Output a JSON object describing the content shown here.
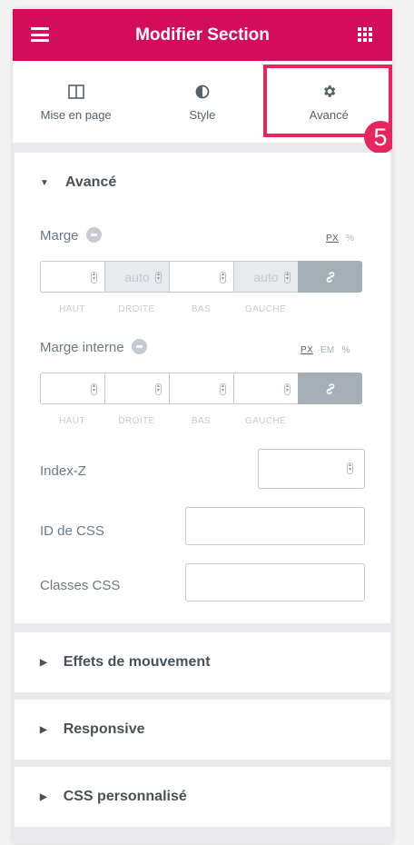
{
  "header": {
    "title": "Modifier Section"
  },
  "tabs": [
    {
      "label": "Mise en page",
      "icon": "columns-icon"
    },
    {
      "label": "Style",
      "icon": "contrast-icon"
    },
    {
      "label": "Avancé",
      "icon": "gear-icon"
    }
  ],
  "annotation": {
    "step": "5",
    "color": "#e8265e"
  },
  "advanced": {
    "title": "Avancé",
    "marge": {
      "label": "Marge",
      "units": [
        "PX",
        "%"
      ],
      "fields": [
        {
          "value": "",
          "label": "HAUT"
        },
        {
          "value": "auto",
          "label": "DROITE"
        },
        {
          "value": "",
          "label": "BAS"
        },
        {
          "value": "auto",
          "label": "GAUCHE"
        }
      ]
    },
    "marge_interne": {
      "label": "Marge interne",
      "units": [
        "PX",
        "EM",
        "%"
      ],
      "fields": [
        {
          "value": "",
          "label": "HAUT"
        },
        {
          "value": "",
          "label": "DROITE"
        },
        {
          "value": "",
          "label": "BAS"
        },
        {
          "value": "",
          "label": "GAUCHE"
        }
      ]
    },
    "zindex_label": "Index-Z",
    "css_id_label": "ID de CSS",
    "css_classes_label": "Classes CSS"
  },
  "sections": [
    {
      "title": "Effets de mouvement"
    },
    {
      "title": "Responsive"
    },
    {
      "title": "CSS personnalisé"
    }
  ],
  "colors": {
    "brand": "#d30c5c"
  }
}
